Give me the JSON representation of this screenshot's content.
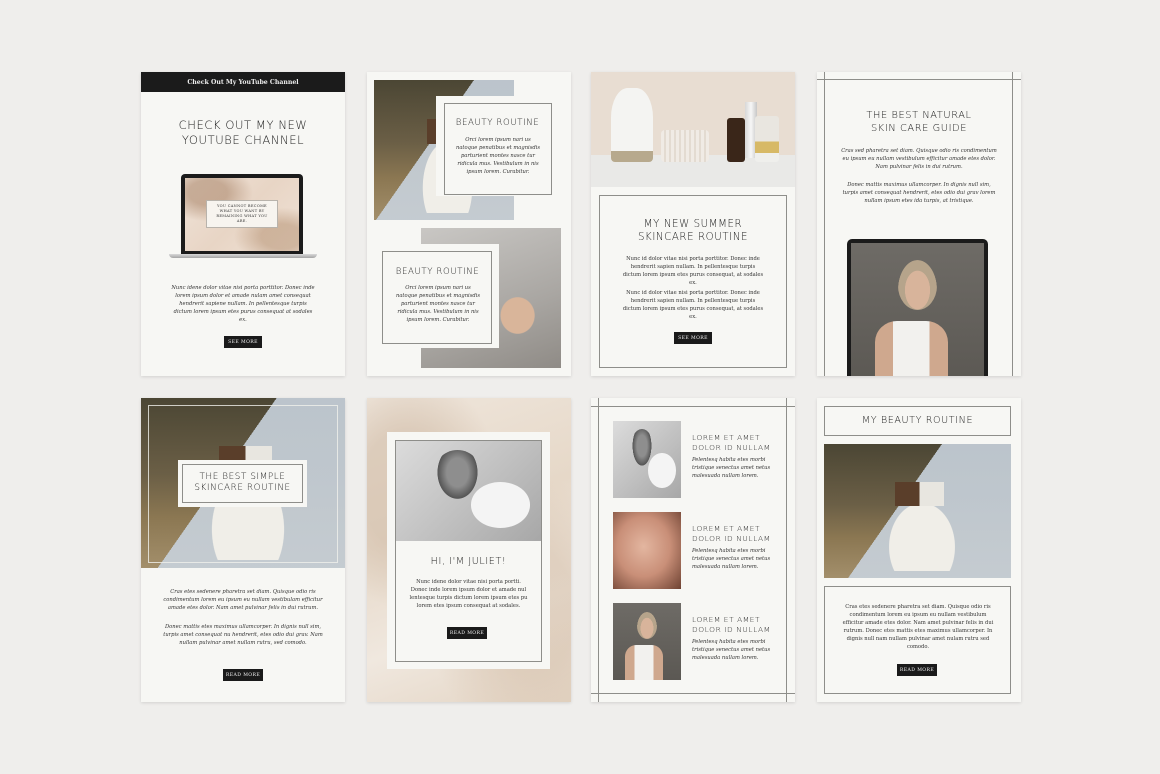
{
  "templates": [
    {
      "id": "youtube",
      "header_bar": "Check Out My YouTube Channel",
      "title_line1": "CHECK OUT MY NEW",
      "title_line2": "YOUTUBE CHANNEL",
      "laptop_quote": "YOU CANNOT BECOME WHAT YOU WANT BY REMAINING WHAT YOU ARE.",
      "body": "Nunc idene dolor vitae nisi porta porttitor. Donec inde lorem ipsum dolor et amade nulam amet consequat hendrerit sapiene nullam. In pellentesque turpis dictum lorem ipsum etes purus consequat at sodales ex.",
      "button": "SEE MORE"
    },
    {
      "id": "beauty-routine-collage",
      "block1_title": "BEAUTY ROUTINE",
      "block1_body": "Orci lorem ipsum nari us natoque penatibus et magnisdis parturient montes nasce tur ridicula mus. Vestibulum in nis ipsum lorem. Curabitur.",
      "block2_title": "BEAUTY ROUTINE",
      "block2_body": "Orci lorem ipsum nari us natoque penatibus et magnisdis parturient montes nasce tur ridicula mus. Vestibulum in nis ipsum lorem. Curabitur."
    },
    {
      "id": "summer-skincare",
      "title_line1": "MY NEW SUMMER",
      "title_line2": "SKINCARE ROUTINE",
      "body1": "Nunc id dolor vitae nisi porta porttitor. Donec inde hendrerit sapien nullam. In pellentesque turpis dictum lorem ipsum etes purus consequat, at sodales ex.",
      "body2": "Nunc id dolor vitae nisi porta porttitor. Donec inde hendrerit sapien nullam. In pellentesque turpis dictum lorem ipsum etes purus consequat, at sodales ex.",
      "button": "SEE MORE"
    },
    {
      "id": "natural-skin-care",
      "title_line1": "THE BEST NATURAL",
      "title_line2": "SKIN CARE GUIDE",
      "body1": "Cras sed pharetra set diam. Quisque odio ris condimentum eu ipsum eu nullam vestibulum efficitur amade etes dolor. Nam pulvinar felis in dui rutrum.",
      "body2": "Donec mattis maximus ullamcorper. In dignis null sim, turpis amet consequat hendrerit, etes odio dui grav lorem nullam ipsum etes ida turpis, at tristique."
    },
    {
      "id": "simple-skincare",
      "title_line1": "THE BEST SIMPLE",
      "title_line2": "SKINCARE ROUTINE",
      "body1": "Cras etes sedenere pharetra set diam. Quisque odio ris condimentum lorem eu ipsum eu nullam vestibulam efficitur amade etes dolor. Nam amet pulvinar felis in dui rutrum.",
      "body2": "Donec mattis etes maximus ullamcorper. In dignis null sim, turpis amet consequat nu hendrerit, etes odio dui grav. Nam nullam pulvinar amet nullam rutru, sed comodo.",
      "button": "READ MORE"
    },
    {
      "id": "hi-juliet",
      "title": "HI, I'M JULIET!",
      "body": "Nunc idene dolor vitae nisi porta portti. Donec inde lorem ipsum dolor et amade nul lentesque turpis dictum lorem ipsum etes pu lorem etes ipsum consequat at sodales.",
      "button": "READ MORE"
    },
    {
      "id": "lorem-list",
      "items": [
        {
          "title_line1": "LOREM ET AMET",
          "title_line2": "DOLOR ID NULLAM",
          "body": "Pelentesq habita etes morbi tristique senectus amet netus malesuada nullam lorem."
        },
        {
          "title_line1": "LOREM ET AMET",
          "title_line2": "DOLOR ID NULLAM",
          "body": "Pelentesq habita etes morbi tristique senectus amet netus malesuada nullam lorem."
        },
        {
          "title_line1": "LOREM ET AMET",
          "title_line2": "DOLOR ID NULLAM",
          "body": "Pelentesq habita etes morbi tristique senectus amet netus malesuada nullam lorem."
        }
      ]
    },
    {
      "id": "my-beauty-routine",
      "title": "MY BEAUTY ROUTINE",
      "body": "Cras etes sedenere pharetra set diam. Quisque odio ris condimentum lorem eu ipsum eu nullam vestibulum efficitur amade etes dolor. Nam amet pulvinar felis in dui rutrum. Donec etes mattis etes maximus ullamcorper. In dignis null nam nullam pulvinar amet nulam rutru sed comodo.",
      "button": "READ MORE"
    }
  ]
}
